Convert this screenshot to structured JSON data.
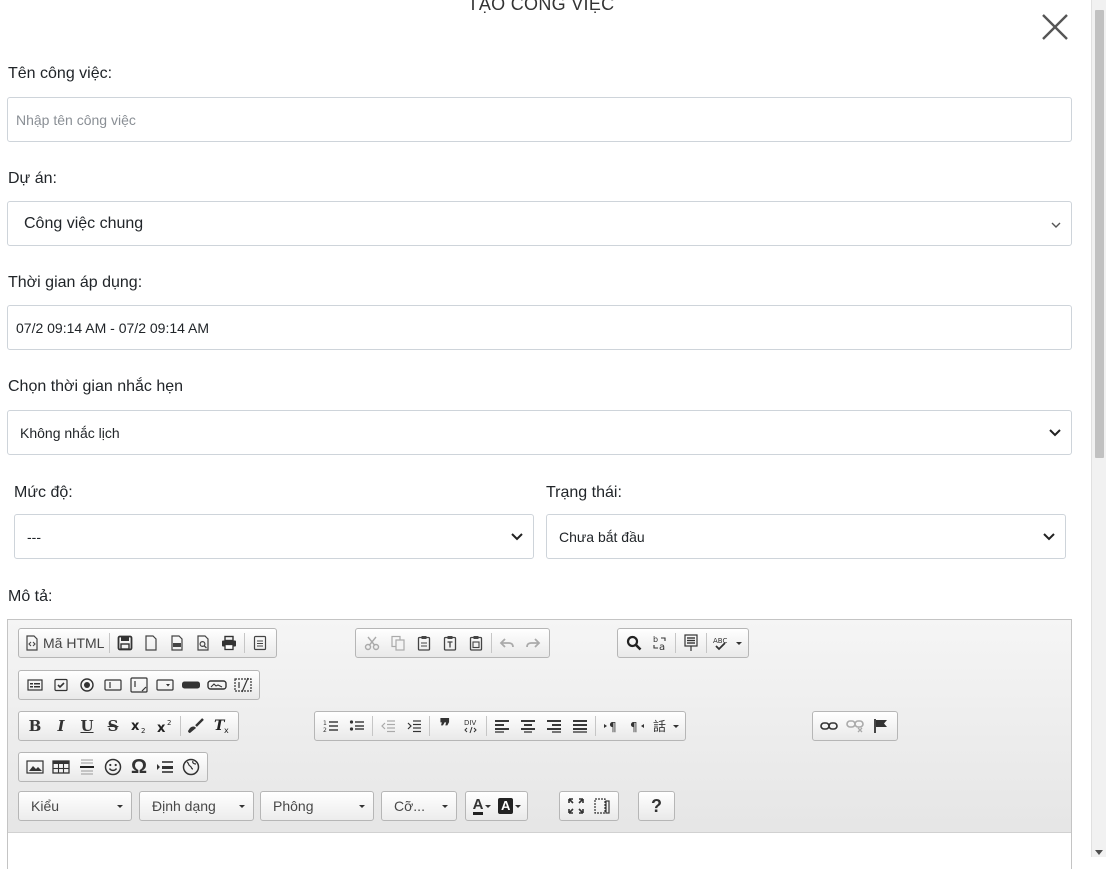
{
  "modal": {
    "title": "TẠO CÔNG VIỆC",
    "close_icon": "close-icon"
  },
  "fields": {
    "task_name": {
      "label": "Tên công việc:",
      "placeholder": "Nhập tên công việc",
      "value": ""
    },
    "project": {
      "label": "Dự án:",
      "selected": "Công việc chung"
    },
    "time_range": {
      "label": "Thời gian áp dụng:",
      "value": "07/2 09:14 AM - 07/2 09:14 AM"
    },
    "reminder": {
      "label": "Chọn thời gian nhắc hẹn",
      "selected": "Không nhắc lịch"
    },
    "priority": {
      "label": "Mức độ:",
      "selected": "---"
    },
    "status": {
      "label": "Trạng thái:",
      "selected": "Chưa bắt đầu"
    },
    "description": {
      "label": "Mô tả:"
    }
  },
  "editor": {
    "source_button": "Mã HTML",
    "combos": {
      "style": "Kiểu",
      "format": "Định dạng",
      "font": "Phông",
      "size": "Cỡ..."
    },
    "help_label": "?",
    "bold_label": "B",
    "italic_label": "I",
    "underline_label": "U",
    "strike_label": "S",
    "omega_label": "Ω",
    "quote_label": "❞",
    "text_color_label": "A",
    "bg_color_label": "A"
  },
  "colors": {
    "border": "#ced4da",
    "toolbar_bg": "#e3e3e3",
    "text": "#212529"
  }
}
